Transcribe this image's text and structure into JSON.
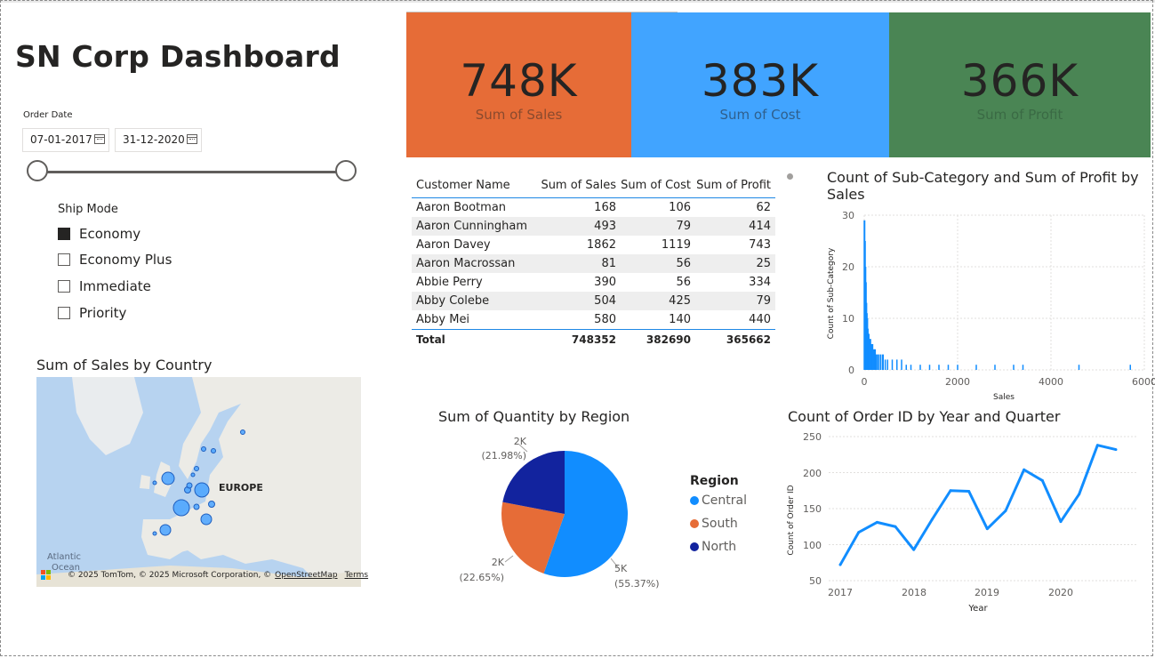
{
  "title": "SN Corp Dashboard",
  "order_date": {
    "label": "Order Date",
    "start": "07-01-2017",
    "end": "31-12-2020"
  },
  "ship_mode": {
    "title": "Ship Mode",
    "options": [
      {
        "label": "Economy",
        "checked": true
      },
      {
        "label": "Economy Plus",
        "checked": false
      },
      {
        "label": "Immediate",
        "checked": false
      },
      {
        "label": "Priority",
        "checked": false
      }
    ]
  },
  "cards": [
    {
      "value": "748K",
      "label": "Sum of Sales",
      "bg": "#E66C37",
      "label_color": "#8a4a2e"
    },
    {
      "value": "383K",
      "label": "Sum of Cost",
      "bg": "#41A4FF",
      "label_color": "#2f5f8c"
    },
    {
      "value": "366K",
      "label": "Sum of Profit",
      "bg": "#4A8554",
      "label_color": "#3a6a44"
    }
  ],
  "table": {
    "headers": [
      "Customer Name",
      "Sum of Sales",
      "Sum of Cost",
      "Sum of Profit"
    ],
    "rows": [
      [
        "Aaron Bootman",
        "168",
        "106",
        "62"
      ],
      [
        "Aaron Cunningham",
        "493",
        "79",
        "414"
      ],
      [
        "Aaron Davey",
        "1862",
        "1119",
        "743"
      ],
      [
        "Aaron Macrossan",
        "81",
        "56",
        "25"
      ],
      [
        "Abbie Perry",
        "390",
        "56",
        "334"
      ],
      [
        "Abby Colebe",
        "504",
        "425",
        "79"
      ],
      [
        "Abby Mei",
        "580",
        "140",
        "440"
      ]
    ],
    "total": [
      "Total",
      "748352",
      "382690",
      "365662"
    ]
  },
  "histogram": {
    "title_line1": "Count of Sub-Category and Sum of Profit by",
    "title_line2": "Sales",
    "ylabel": "Count of Sub-Category",
    "xlabel": "Sales",
    "yticks": [
      "30",
      "20",
      "10",
      "0"
    ],
    "xticks": [
      "0",
      "2000",
      "4000",
      "6000"
    ]
  },
  "map": {
    "title": "Sum of Sales by Country",
    "region_label": "EUROPE",
    "ocean_label_1": "Atlantic",
    "ocean_label_2": "Ocean",
    "credit": "© 2025 TomTom, © 2025 Microsoft Corporation, ©",
    "credit_link1": "OpenStreetMap",
    "credit_link2": "Terms"
  },
  "pie": {
    "title": "Sum of Quantity by Region",
    "legend_title": "Region",
    "labels": [
      {
        "value": "5K",
        "pct": "(55.37%)"
      },
      {
        "value": "2K",
        "pct": "(22.65%)"
      },
      {
        "value": "2K",
        "pct": "(21.98%)"
      }
    ]
  },
  "line": {
    "title": "Count of Order ID by Year and Quarter",
    "ylabel": "Count of Order ID",
    "xlabel": "Year",
    "yticks": [
      "250",
      "200",
      "150",
      "100",
      "50"
    ],
    "xticks": [
      "2017",
      "2018",
      "2019",
      "2020"
    ]
  },
  "chart_data": [
    {
      "type": "pie",
      "title": "Sum of Quantity by Region",
      "categories": [
        "Central",
        "South",
        "North"
      ],
      "values": [
        55.37,
        22.65,
        21.98
      ],
      "colors": [
        "#118DFF",
        "#E66C37",
        "#12239E"
      ],
      "legend": "right"
    },
    {
      "type": "line",
      "title": "Count of Order ID by Year and Quarter",
      "xlabel": "Year",
      "ylabel": "Count of Order ID",
      "x": [
        "2017 Q1",
        "2017 Q2",
        "2017 Q3",
        "2017 Q4",
        "2018 Q1",
        "2018 Q2",
        "2018 Q3",
        "2018 Q4",
        "2019 Q1",
        "2019 Q2",
        "2019 Q3",
        "2019 Q4",
        "2020 Q1",
        "2020 Q2",
        "2020 Q3",
        "2020 Q4"
      ],
      "values": [
        72,
        117,
        131,
        125,
        93,
        135,
        175,
        174,
        122,
        147,
        204,
        189,
        132,
        170,
        238,
        232
      ],
      "ylim": [
        50,
        250
      ],
      "color": "#118DFF",
      "grid": true
    },
    {
      "type": "bar",
      "title": "Count of Sub-Category and Sum of Profit by Sales",
      "xlabel": "Sales",
      "ylabel": "Count of Sub-Category",
      "x": [
        5,
        15,
        25,
        35,
        45,
        55,
        65,
        75,
        85,
        95,
        110,
        130,
        150,
        175,
        200,
        230,
        260,
        300,
        350,
        400,
        450,
        500,
        600,
        700,
        800,
        900,
        1000,
        1200,
        1400,
        1600,
        1800,
        2000,
        2400,
        2800,
        3200,
        3400,
        4600,
        5700
      ],
      "values": [
        29,
        25,
        20,
        17,
        13,
        11,
        10,
        8,
        7,
        7,
        6,
        6,
        5,
        5,
        4,
        4,
        3,
        3,
        3,
        3,
        2,
        2,
        2,
        2,
        2,
        1,
        1,
        1,
        1,
        1,
        1,
        1,
        1,
        1,
        1,
        1,
        1,
        1
      ],
      "xlim": [
        0,
        6000
      ],
      "ylim": [
        0,
        30
      ],
      "color": "#118DFF",
      "grid": true
    }
  ]
}
